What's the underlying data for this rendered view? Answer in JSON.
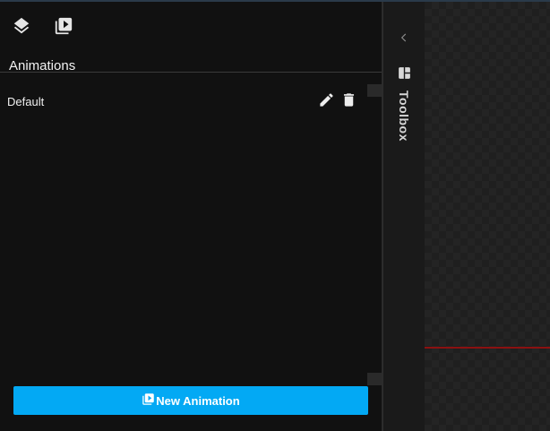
{
  "panel": {
    "toolbar": {
      "layers_icon": "layers-icon",
      "animations_icon": "animation-library-icon"
    },
    "section_title": "Animations",
    "animations": [
      {
        "label": "Default",
        "edit_icon": "pencil-icon",
        "delete_icon": "trash-icon"
      }
    ],
    "new_animation_button": {
      "label": "New Animation",
      "icon": "animation-library-icon"
    }
  },
  "toolbox": {
    "label": "Toolbox",
    "collapse_icon": "chevron-left-icon",
    "icon": "toolbox-icon"
  },
  "colors": {
    "accent": "#03a9f4",
    "panel_bg": "#111111",
    "canvas_line": "#8b1111"
  }
}
